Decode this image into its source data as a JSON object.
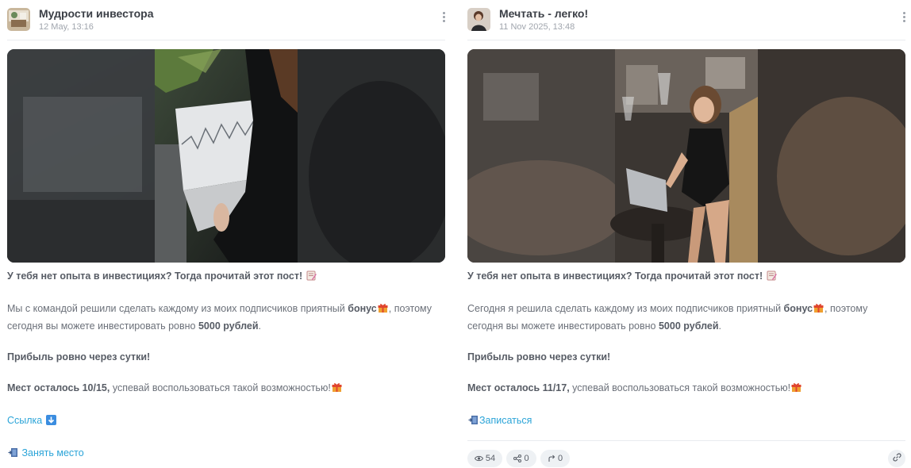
{
  "posts": [
    {
      "channel": "Мудрости инвестора",
      "date": "12 May, 13:16",
      "headline": "У тебя нет опыта в инвестициях? Тогда прочитай этот пост!",
      "intro_before": "Мы с командой решили сделать каждому из моих подписчиков приятный",
      "bonus_word": "бонус",
      "intro_after": ", поэтому",
      "line2_before": "сегодня вы можете инвестировать ровно",
      "amount": "5000 рублей",
      "line2_after": ".",
      "profit": "Прибыль ровно через сутки!",
      "seats_bold": "Мест осталось 10/15,",
      "seats_rest": "успевай воспользоваться такой возможностью!",
      "link1": "Ссылка",
      "link2": "Занять место",
      "icons": [
        "memo-icon",
        "gift-icon",
        "down-arrow-icon",
        "door-icon"
      ]
    },
    {
      "channel": "Мечтать - легко!",
      "date": "11 Nov 2025, 13:48",
      "headline": "У тебя нет опыта в инвестициях? Тогда прочитай этот пост!",
      "intro_before": "Сегодня я решила сделать каждому из моих подписчиков приятный",
      "bonus_word": "бонус",
      "intro_after": ", поэтому",
      "line2_before": "сегодня вы можете инвестировать ровно",
      "amount": "5000 рублей",
      "line2_after": ".",
      "profit": "Прибыль ровно через сутки!",
      "seats_bold": "Мест осталось 11/17,",
      "seats_rest": "успевай воспользоваться такой возможностью!",
      "link1": "Записаться",
      "views": "54",
      "shares": "0",
      "forwards": "0",
      "icons": [
        "memo-icon",
        "gift-icon",
        "door-icon",
        "eye-icon",
        "share-icon",
        "forward-icon",
        "link-icon"
      ]
    }
  ],
  "colors": {
    "link": "#2ba4d8",
    "chip_bg": "#eef1f4",
    "divider": "#e9ecef"
  }
}
